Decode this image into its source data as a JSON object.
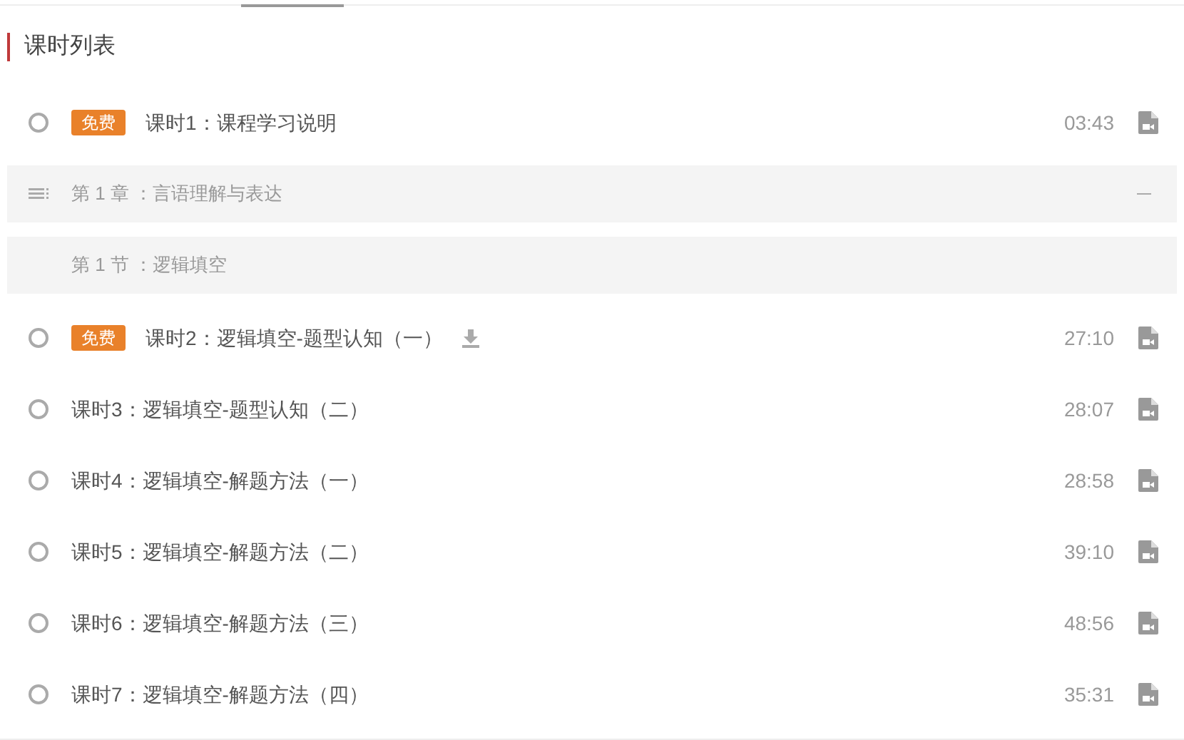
{
  "title": "课时列表",
  "items": [
    {
      "kind": "lesson",
      "selected": false,
      "badge": "免费",
      "title": "课时1：课程学习说明",
      "duration": "03:43",
      "download": false
    },
    {
      "kind": "chapter",
      "title": "第 1 章 ：言语理解与表达",
      "expanded": true
    },
    {
      "kind": "section",
      "title": "第 1 节 ：逻辑填空"
    },
    {
      "kind": "lesson",
      "selected": false,
      "badge": "免费",
      "title": "课时2：逻辑填空-题型认知（一）",
      "duration": "27:10",
      "download": true
    },
    {
      "kind": "lesson",
      "selected": false,
      "title": "课时3：逻辑填空-题型认知（二）",
      "duration": "28:07",
      "download": false
    },
    {
      "kind": "lesson",
      "selected": false,
      "title": "课时4：逻辑填空-解题方法（一）",
      "duration": "28:58",
      "download": false
    },
    {
      "kind": "lesson",
      "selected": false,
      "title": "课时5：逻辑填空-解题方法（二）",
      "duration": "39:10",
      "download": false
    },
    {
      "kind": "lesson",
      "selected": false,
      "title": "课时6：逻辑填空-解题方法（三）",
      "duration": "48:56",
      "download": false
    },
    {
      "kind": "lesson",
      "selected": false,
      "title": "课时7：逻辑填空-解题方法（四）",
      "duration": "35:31",
      "download": false
    }
  ]
}
